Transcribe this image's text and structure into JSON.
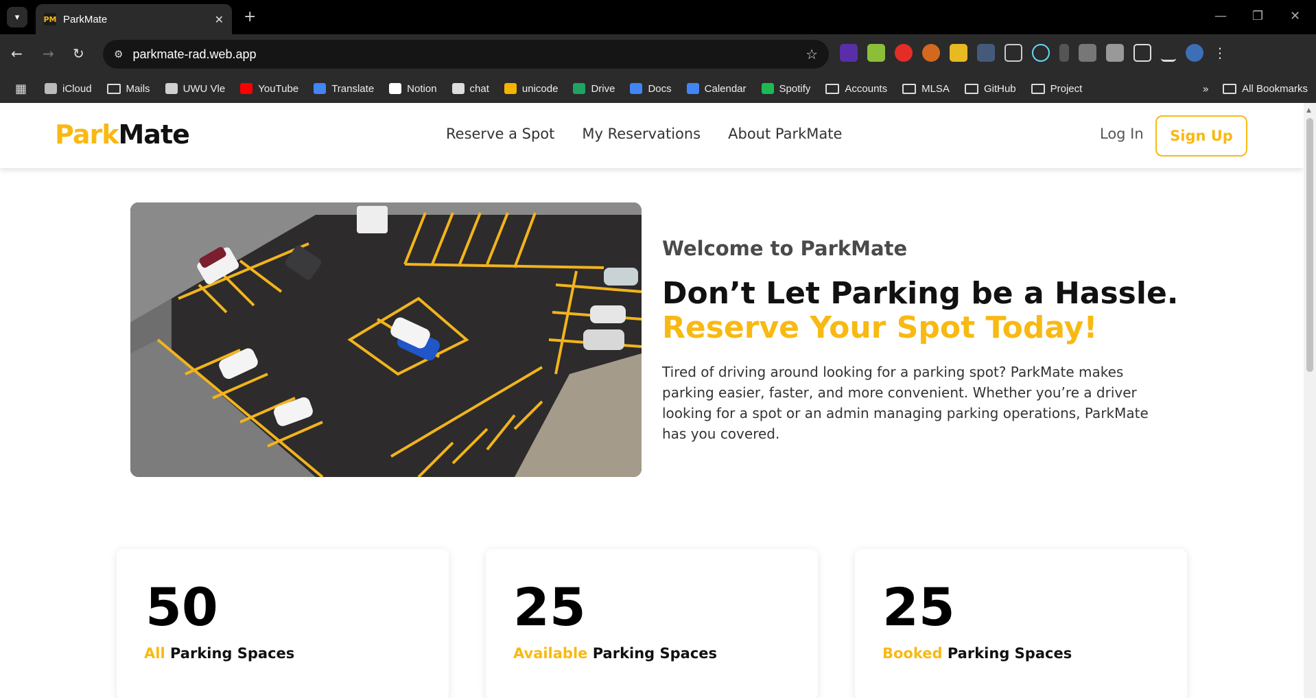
{
  "browser": {
    "tab_title": "ParkMate",
    "tab_favicon": "PM",
    "url": "parkmate-rad.web.app",
    "bookmarks": [
      {
        "label": "iCloud",
        "icon": "apple-icon",
        "color": "#bbbbbb"
      },
      {
        "label": "Mails",
        "icon": "folder-icon"
      },
      {
        "label": "UWU Vle",
        "icon": "uwu-icon",
        "color": "#d0d0d0"
      },
      {
        "label": "YouTube",
        "icon": "youtube-icon",
        "color": "#ff0000"
      },
      {
        "label": "Translate",
        "icon": "translate-icon",
        "color": "#4285f4"
      },
      {
        "label": "Notion",
        "icon": "notion-icon",
        "color": "#ffffff"
      },
      {
        "label": "chat",
        "icon": "chatgpt-icon",
        "color": "#dddddd"
      },
      {
        "label": "unicode",
        "icon": "unicode-icon",
        "color": "#f5b400"
      },
      {
        "label": "Drive",
        "icon": "drive-icon",
        "color": "#1fa463"
      },
      {
        "label": "Docs",
        "icon": "docs-icon",
        "color": "#4285f4"
      },
      {
        "label": "Calendar",
        "icon": "calendar-icon",
        "color": "#4285f4"
      },
      {
        "label": "Spotify",
        "icon": "spotify-icon",
        "color": "#1db954"
      },
      {
        "label": "Accounts",
        "icon": "folder-icon"
      },
      {
        "label": "MLSA",
        "icon": "folder-icon"
      },
      {
        "label": "GitHub",
        "icon": "folder-icon"
      },
      {
        "label": "Project",
        "icon": "folder-icon"
      }
    ],
    "all_bookmarks": "All Bookmarks",
    "more_bookmarks": "»"
  },
  "site": {
    "logo_part1": "Park",
    "logo_part2": "Mate",
    "nav": [
      "Reserve a Spot",
      "My Reservations",
      "About ParkMate"
    ],
    "login": "Log In",
    "signup": "Sign Up",
    "accent_color": "#f8b912"
  },
  "hero": {
    "welcome": "Welcome to ParkMate",
    "headline": "Don’t Let Parking be a Hassle.",
    "headline_accent": "Reserve Your Spot Today!",
    "paragraph": "Tired of driving around looking for a parking spot? ParkMate makes parking easier, faster, and more convenient. Whether you’re a driver looking for a spot or an admin managing parking operations, ParkMate has you covered.",
    "image": "aerial-parking-lot-photo"
  },
  "stats": [
    {
      "value": "50",
      "highlight": "All",
      "label": " Parking Spaces"
    },
    {
      "value": "25",
      "highlight": "Available",
      "label": " Parking Spaces"
    },
    {
      "value": "25",
      "highlight": "Booked",
      "label": " Parking Spaces"
    }
  ]
}
